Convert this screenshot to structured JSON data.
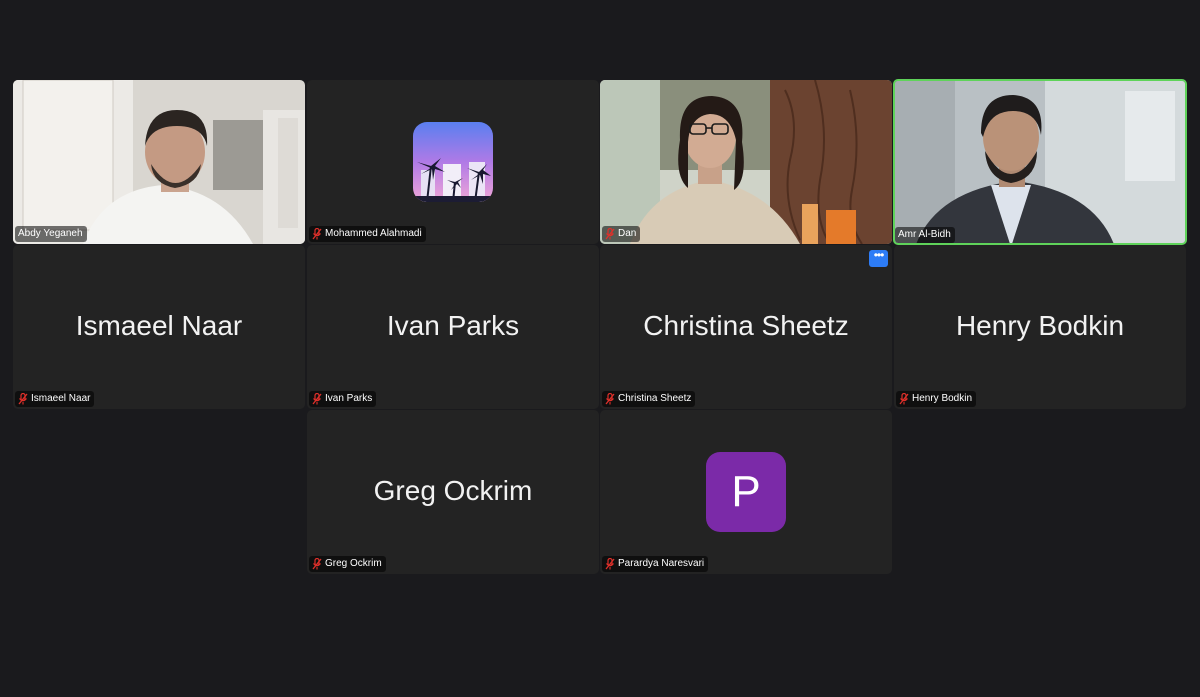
{
  "participants": [
    {
      "display": "",
      "tag": "Abdy Yeganeh",
      "muted": false
    },
    {
      "display": "",
      "tag": "Mohammed Alahmadi",
      "muted": true
    },
    {
      "display": "",
      "tag": "Dan",
      "muted": true
    },
    {
      "display": "",
      "tag": "Amr Al-Bidh",
      "muted": false,
      "active_speaker": true
    },
    {
      "display": "Ismaeel Naar",
      "tag": "Ismaeel Naar",
      "muted": true
    },
    {
      "display": "Ivan Parks",
      "tag": "Ivan Parks",
      "muted": true
    },
    {
      "display": "Christina Sheetz",
      "tag": "Christina Sheetz",
      "muted": true
    },
    {
      "display": "Henry Bodkin",
      "tag": "Henry Bodkin",
      "muted": true
    },
    {
      "display": "Greg Ockrim",
      "tag": "Greg Ockrim",
      "muted": true
    },
    {
      "display": "",
      "tag": "Parardya Naresvari",
      "muted": true,
      "avatar_letter": "P"
    }
  ],
  "more_button": "•••",
  "colors": {
    "background": "#1a1a1d",
    "tile": "#232323",
    "active_border": "#5fd35a",
    "muted_icon": "#e0302a",
    "avatar_purple": "#7b2aa8",
    "more_button": "#2d7cf6"
  }
}
